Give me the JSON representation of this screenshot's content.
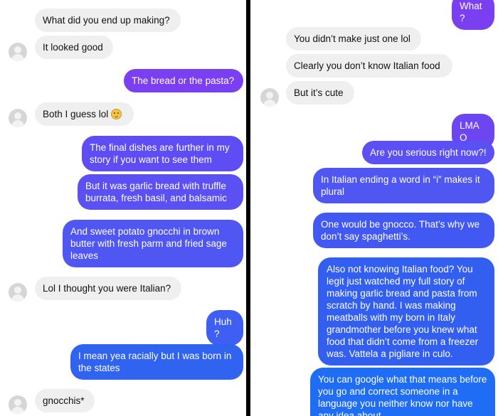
{
  "colors": {
    "incoming_bg": "#efefef",
    "outgoing_purple": "#7a3ff0",
    "outgoing_violet": "#5e4cf4",
    "outgoing_blue": "#2f63f0",
    "outgoing_bright_blue": "#1f6df5"
  },
  "left": {
    "messages": [
      {
        "text": "What did you end up making?"
      },
      {
        "text": "It looked good"
      },
      {
        "text": "The bread or the pasta?"
      },
      {
        "text": "Both I guess lol",
        "emoji": "grimacing-face-emoji"
      },
      {
        "text": "The final dishes are further in my story if you want to see them"
      },
      {
        "text": "But it was garlic bread with truffle burrata, fresh basil, and balsamic"
      },
      {
        "text": "And sweet potato gnocchi in brown butter with fresh parm and fried sage leaves"
      },
      {
        "text": "Lol I thought you were Italian?"
      },
      {
        "text": "Huh?"
      },
      {
        "text": "I mean yea racially but I was born in the states"
      },
      {
        "text": "gnocchis*"
      }
    ]
  },
  "right": {
    "messages": [
      {
        "text": "What?"
      },
      {
        "text": "You didn’t make just one lol"
      },
      {
        "text": "Clearly you don’t know Italian food"
      },
      {
        "text": "But it’s cute"
      },
      {
        "text": "LMAO"
      },
      {
        "text": "Are you serious right now?!"
      },
      {
        "text": "In Italian ending a word in “i” makes it plural"
      },
      {
        "text": "One would be gnocco. That’s why we don’t say spaghetti’s."
      },
      {
        "text": "Also not knowing Italian food? You legit just watched my full story of making garlic bread and pasta from scratch by hand. I was making meatballs with my born in Italy grandmother before you knew what food that didn’t come from a freezer was. Vattela a pigliare in culo."
      },
      {
        "text": "You can google what that means before you go and correct someone in a language you neither know nor have any idea about"
      }
    ]
  }
}
